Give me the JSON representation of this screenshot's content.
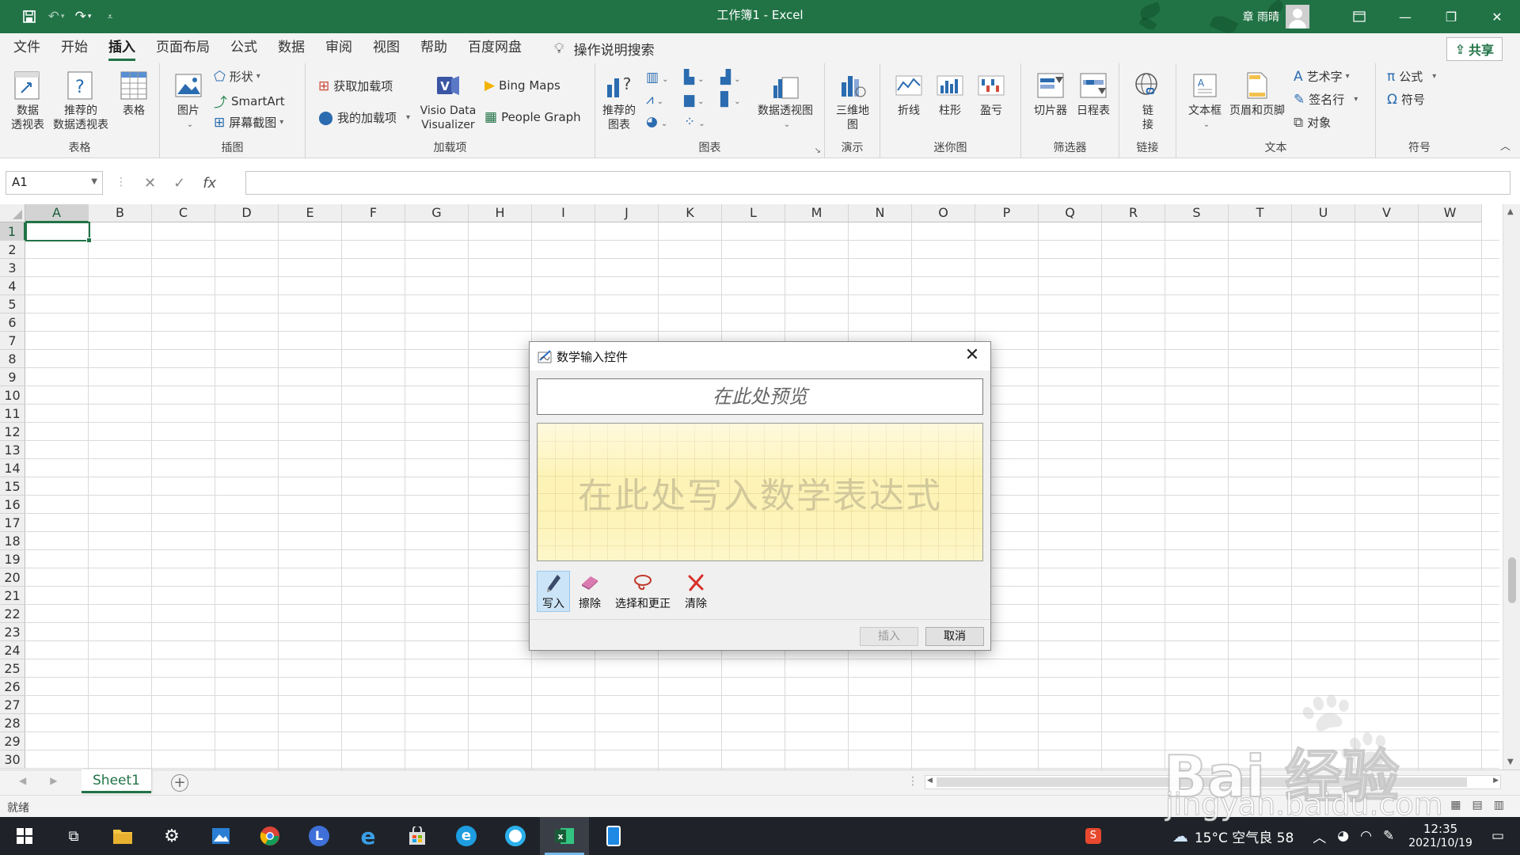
{
  "titlebar": {
    "title": "工作簿1  -  Excel",
    "user": "章 雨晴"
  },
  "menu": {
    "tabs": [
      "文件",
      "开始",
      "插入",
      "页面布局",
      "公式",
      "数据",
      "审阅",
      "视图",
      "帮助",
      "百度网盘"
    ],
    "active_tab": "插入",
    "tell_me": "操作说明搜索",
    "share": "共享"
  },
  "ribbon": {
    "tables": {
      "label": "表格",
      "pivot": "数据\n透视表",
      "recommended_pivot": "推荐的\n数据透视表",
      "table": "表格"
    },
    "illustrations": {
      "label": "插图",
      "pictures": "图片",
      "shapes": "形状",
      "smartart": "SmartArt",
      "screenshot": "屏幕截图"
    },
    "addins": {
      "label": "加载项",
      "get_addins": "获取加载项",
      "my_addins": "我的加载项",
      "visio": "Visio Data\nVisualizer",
      "bing_maps": "Bing Maps",
      "people_graph": "People Graph"
    },
    "charts": {
      "label": "图表",
      "recommended": "推荐的\n图表",
      "pivotchart": "数据透视图"
    },
    "tours": {
      "label": "演示",
      "map3d": "三维地\n图"
    },
    "sparklines": {
      "label": "迷你图",
      "line": "折线",
      "column": "柱形",
      "winloss": "盈亏"
    },
    "filters": {
      "label": "筛选器",
      "slicer": "切片器",
      "timeline": "日程表"
    },
    "links": {
      "label": "链接",
      "link": "链\n接"
    },
    "text": {
      "label": "文本",
      "textbox": "文本框",
      "header_footer": "页眉和页脚",
      "wordart": "艺术字",
      "signature": "签名行",
      "object": "对象"
    },
    "symbols": {
      "label": "符号",
      "equation": "公式",
      "symbol": "符号"
    }
  },
  "formula_bar": {
    "name_box": "A1",
    "fx": "fx",
    "value": ""
  },
  "grid": {
    "columns": [
      "A",
      "B",
      "C",
      "D",
      "E",
      "F",
      "G",
      "H",
      "I",
      "J",
      "K",
      "L",
      "M",
      "N",
      "O",
      "P",
      "Q",
      "R",
      "S",
      "T",
      "U",
      "V",
      "W"
    ],
    "rows": [
      "1",
      "2",
      "3",
      "4",
      "5",
      "6",
      "7",
      "8",
      "9",
      "10",
      "11",
      "12",
      "13",
      "14",
      "15",
      "16",
      "17",
      "18",
      "19",
      "20",
      "21",
      "22",
      "23",
      "24",
      "25",
      "26",
      "27",
      "28",
      "29",
      "30"
    ],
    "active_cell": "A1"
  },
  "sheets": {
    "tabs": [
      "Sheet1"
    ],
    "add": "⊕"
  },
  "status": {
    "ready": "就绪"
  },
  "dialog": {
    "title": "数学输入控件",
    "preview_placeholder": "在此处预览",
    "write_placeholder": "在此处写入数学表达式",
    "tools": {
      "write": "写入",
      "erase": "擦除",
      "select_correct": "选择和更正",
      "clear": "清除"
    },
    "insert": "插入",
    "cancel": "取消"
  },
  "taskbar": {
    "weather": "15°C  空气良 58",
    "time": "12:35",
    "date": "2021/10/19"
  },
  "watermark": {
    "brand": "Bai  经验",
    "url": "jingyan.baidu.com"
  }
}
